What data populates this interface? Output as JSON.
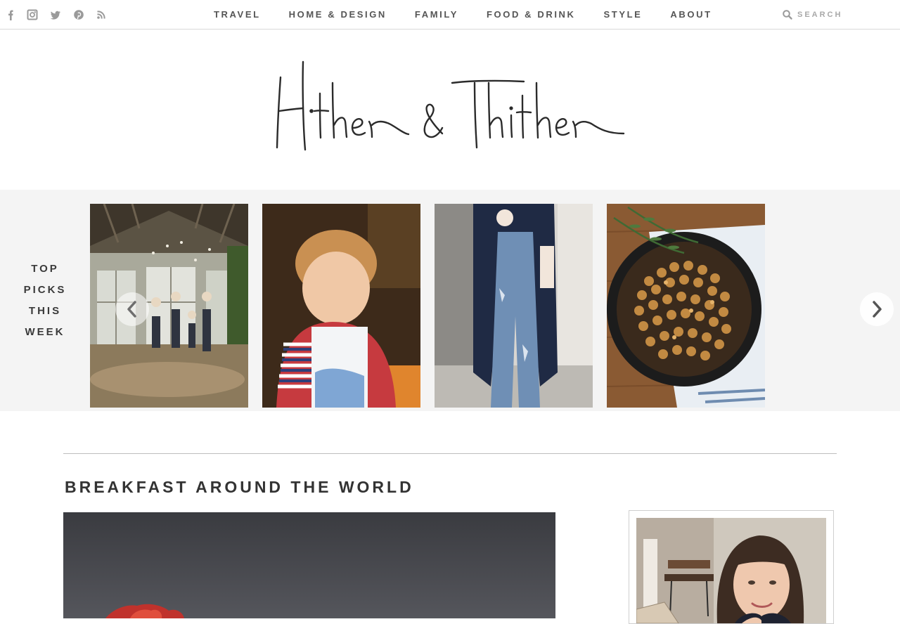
{
  "social": {
    "icons": [
      "facebook-icon",
      "instagram-icon",
      "twitter-icon",
      "pinterest-icon",
      "rss-icon"
    ],
    "color": "#9a9a9a"
  },
  "nav": {
    "items": [
      {
        "label": "TRAVEL"
      },
      {
        "label": "HOME & DESIGN"
      },
      {
        "label": "FAMILY"
      },
      {
        "label": "FOOD & DRINK"
      },
      {
        "label": "STYLE"
      },
      {
        "label": "ABOUT"
      }
    ]
  },
  "search": {
    "placeholder": "SEARCH"
  },
  "logo": {
    "text": "Hither & Thither"
  },
  "top_picks": {
    "label_lines": [
      "TOP",
      "PICKS",
      "THIS",
      "WEEK"
    ],
    "slides": [
      {
        "subject": "family jumping in a garden shed"
      },
      {
        "subject": "toddler in striped cardigan"
      },
      {
        "subject": "navy coat and ripped jeans outfit"
      },
      {
        "subject": "skillet of roasted chickpeas with rosemary"
      }
    ]
  },
  "post": {
    "title": "BREAKFAST AROUND THE WORLD"
  },
  "colors": {
    "carousel_bg": "#f4f4f4",
    "text": "#333333",
    "divider": "#bdbdbd"
  }
}
